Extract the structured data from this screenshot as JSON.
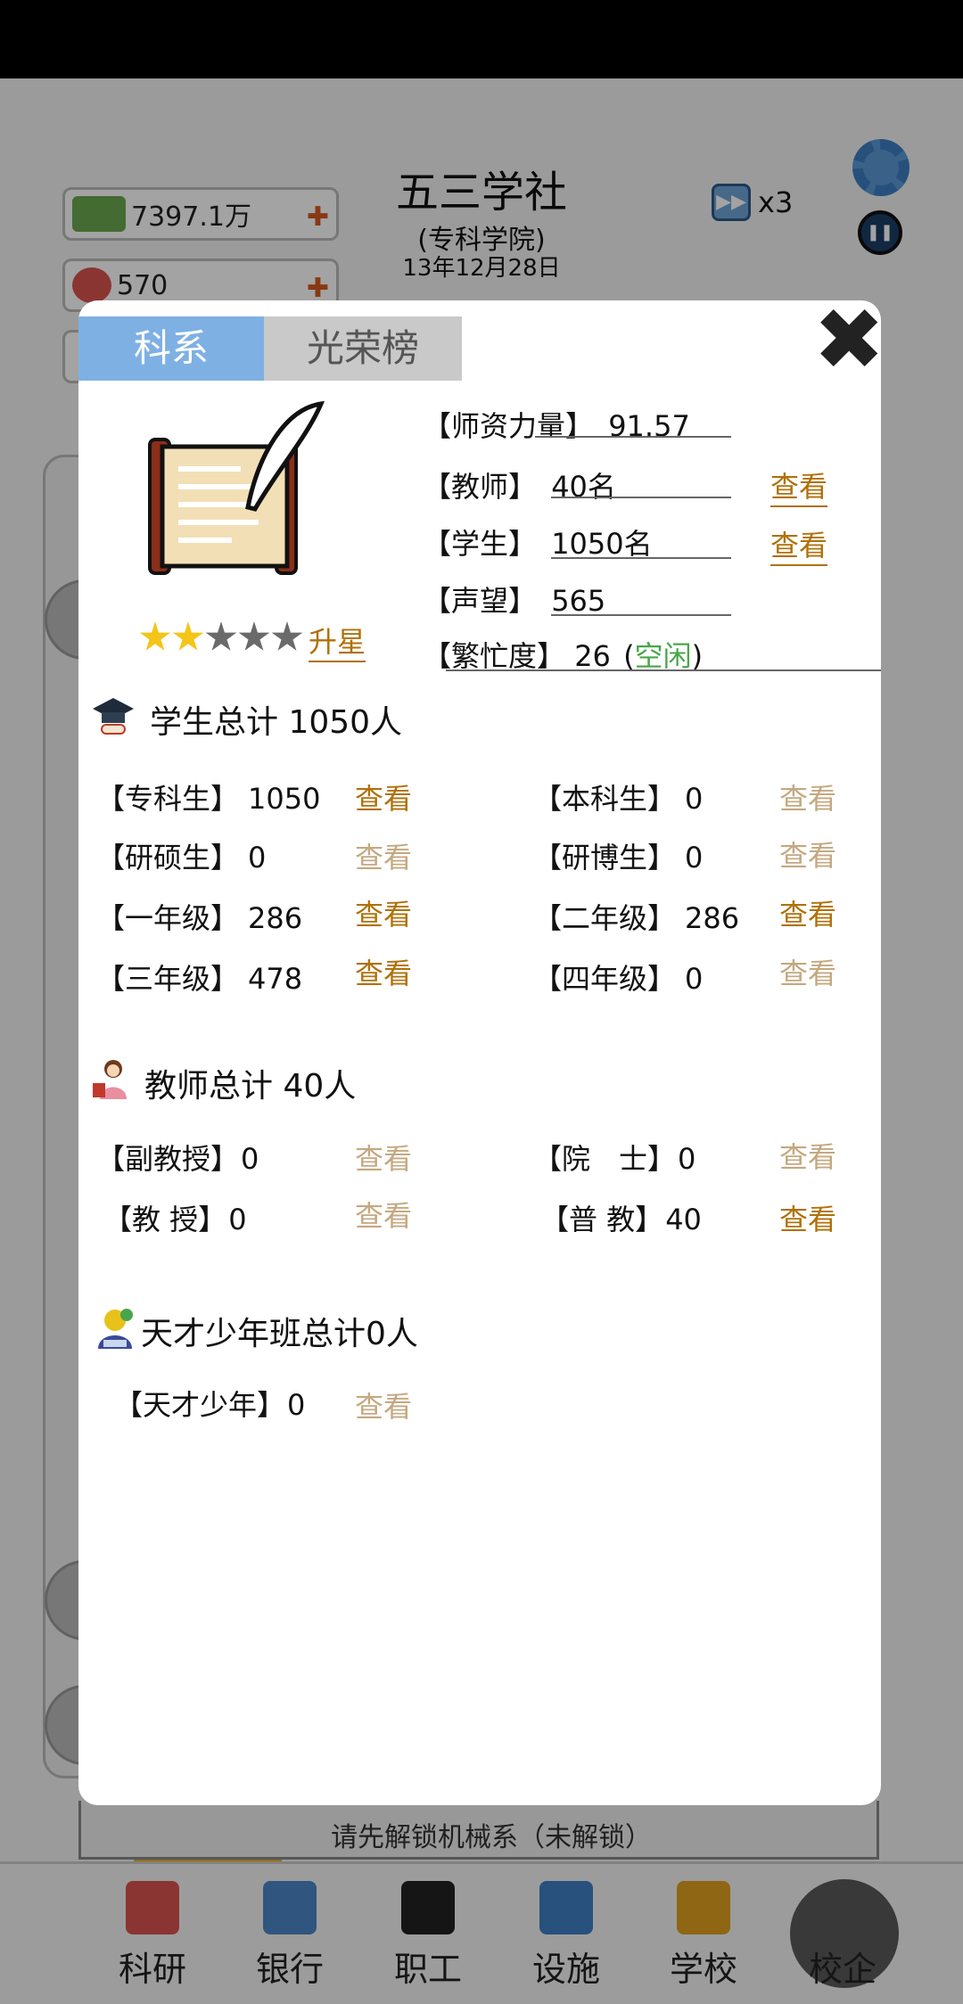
{
  "header": {
    "school_name": "五三学社",
    "school_type": "(专科学院)",
    "date": "13年12月28日",
    "speed_label": "x3",
    "money": "7397.1万",
    "hearts": "570"
  },
  "modal": {
    "tabs": [
      "科系",
      "光荣榜"
    ],
    "upgrade_label": "升星",
    "stars_filled": 2,
    "stars_total": 5,
    "info": {
      "faculty_strength_label": "【师资力量】",
      "faculty_strength_value": "91.57",
      "teachers_label": "【教师】",
      "teachers_value": "40名",
      "students_label": "【学生】",
      "students_value": "1050名",
      "reputation_label": "【声望】",
      "reputation_value": "565",
      "busy_label": "【繁忙度】",
      "busy_value": "26",
      "busy_open": "(",
      "busy_status": "空闲",
      "busy_close": ")",
      "view": "查看"
    },
    "students_section": {
      "title": "学生总计 1050人",
      "rows": [
        {
          "label": "【专科生】",
          "value": "1050",
          "link": "查看"
        },
        {
          "label": "【本科生】",
          "value": "0",
          "link": "查看"
        },
        {
          "label": "【研硕生】",
          "value": "0",
          "link": "查看"
        },
        {
          "label": "【研博生】",
          "value": "0",
          "link": "查看"
        },
        {
          "label": "【一年级】",
          "value": "286",
          "link": "查看"
        },
        {
          "label": "【二年级】",
          "value": "286",
          "link": "查看"
        },
        {
          "label": "【三年级】",
          "value": "478",
          "link": "查看"
        },
        {
          "label": "【四年级】",
          "value": "0",
          "link": "查看"
        }
      ]
    },
    "teachers_section": {
      "title": "教师总计 40人",
      "rows": [
        {
          "label": "【副教授】",
          "value": "0",
          "link": "查看"
        },
        {
          "label": "【院　士】",
          "value": "0",
          "link": "查看"
        },
        {
          "label": "【教 授】",
          "value": "0",
          "link": "查看"
        },
        {
          "label": "【普 教】",
          "value": "40",
          "link": "查看"
        }
      ]
    },
    "gifted_section": {
      "title": "天才少年班总计0人",
      "rows": [
        {
          "label": "【天才少年】",
          "value": "0",
          "link": "查看"
        }
      ]
    }
  },
  "unlock_notice": "请先解锁机械系（未解锁）",
  "nav": [
    "科研",
    "银行",
    "职工",
    "设施",
    "学校",
    "校企"
  ],
  "colors": {
    "tab_active": "#7fb0e4",
    "link_active": "#b0710a",
    "link_inactive": "#c4a880",
    "status_green": "#4aa54a"
  }
}
